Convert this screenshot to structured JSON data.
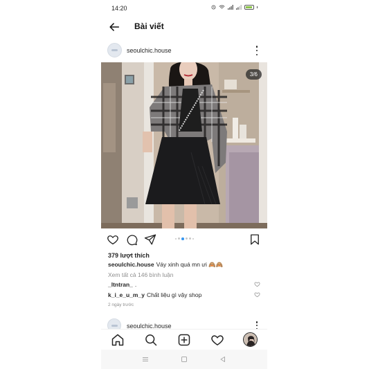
{
  "status_bar": {
    "time": "14:20",
    "battery": "65"
  },
  "header": {
    "title": "Bài viết"
  },
  "post": {
    "username": "seoulchic.house",
    "slide_counter": "3/6",
    "carousel": {
      "total": 6,
      "active_index": 3
    },
    "likes": "379 lượt thích",
    "caption_user": "seoulchic.house",
    "caption_text": "Váy xinh quá mn ưi 🙈🙈",
    "view_comments": "Xem tất cả 146 bình luận",
    "comments": [
      {
        "user": "_ltntran_",
        "text": "."
      },
      {
        "user": "k_i_e_u_m_y",
        "text": "Chất liệu gì vậy shop"
      }
    ],
    "timestamp": "2 ngày trước"
  },
  "next_post": {
    "username": "seoulchic.house"
  },
  "icons": {
    "back": "arrow-left-icon",
    "more": "more-vertical-icon",
    "like": "heart-icon",
    "comment": "comment-icon",
    "share": "send-icon",
    "save": "bookmark-icon",
    "home": "home-icon",
    "search": "search-icon",
    "add": "add-post-icon",
    "activity": "heart-icon",
    "profile": "profile-avatar"
  },
  "colors": {
    "accent": "#3897f0",
    "text": "#262626",
    "muted": "#8e8e8e"
  }
}
